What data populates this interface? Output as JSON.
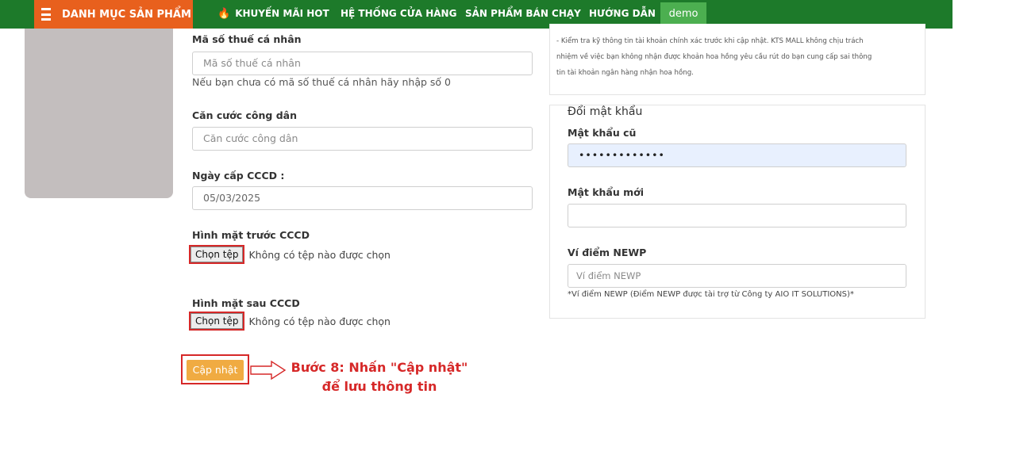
{
  "nav": {
    "category_label": "DANH MỤC SẢN PHẨM",
    "items": [
      {
        "label": "KHUYẾN MÃI HOT",
        "icon": "fire-icon"
      },
      {
        "label": "HỆ THỐNG CỬA HÀNG"
      },
      {
        "label": "SẢN PHẨM BÁN CHẠY"
      },
      {
        "label": "HƯỚNG DẪN"
      }
    ],
    "demo_label": "demo"
  },
  "form": {
    "tax_code": {
      "label": "Mã số thuế cá nhân",
      "placeholder": "Mã số thuế cá nhân",
      "value": "",
      "hint": "Nếu bạn chưa có mã số thuế cá nhân hãy nhập số 0"
    },
    "citizen_id": {
      "label": "Căn cước công dân",
      "placeholder": "Căn cước công dân",
      "value": ""
    },
    "id_issue_date": {
      "label": "Ngày cấp CCCD :",
      "value": "05/03/2025"
    },
    "front_image": {
      "label": "Hình mặt trước CCCD",
      "button": "Chọn tệp",
      "status": "Không có tệp nào được chọn"
    },
    "back_image": {
      "label": "Hình mặt sau CCCD",
      "button": "Chọn tệp",
      "status": "Không có tệp nào được chọn"
    },
    "submit_label": "Cập nhật"
  },
  "annotation": {
    "line1": "Bước 8: Nhấn \"Cập nhật\"",
    "line2": "để lưu thông tin",
    "color": "#d62828"
  },
  "bank_notice": {
    "line1": "- Kiểm tra kỹ thông tin tài khoản chính xác trước khi cập nhật. KTS MALL không chịu trách",
    "line2": "nhiệm về việc bạn không nhận được khoản hoa hồng yêu cầu rút do bạn cung cấp sai thông",
    "line3": "tin tài khoản ngân hàng nhận hoa hồng."
  },
  "password": {
    "title": "Đổi mật khẩu",
    "old_label": "Mật khẩu cũ",
    "old_value": "•••••••••••••",
    "new_label": "Mật khẩu mới",
    "new_value": "",
    "wallet_label": "Ví điểm NEWP",
    "wallet_placeholder": "Ví điểm NEWP",
    "wallet_note": "*Ví điểm NEWP (Điểm NEWP được tài trợ từ Công ty AIO IT SOLUTIONS)*"
  },
  "colors": {
    "nav_green": "#1d7a2a",
    "category_orange": "#e8601d",
    "demo_green": "#4caf50",
    "submit_orange": "#f0ab42",
    "highlight_red": "#d62828"
  }
}
